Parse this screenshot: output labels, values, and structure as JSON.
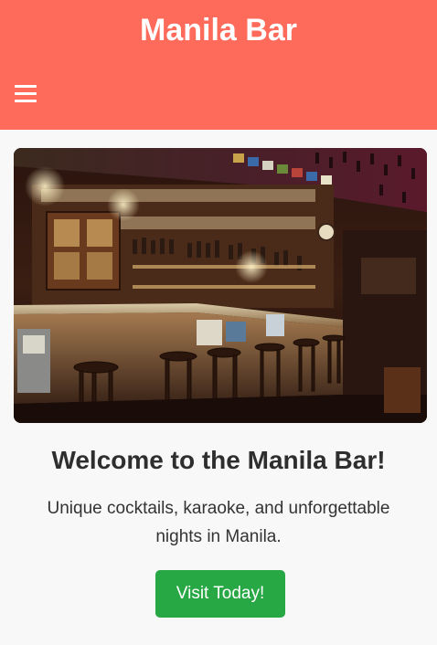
{
  "header": {
    "title": "Manila Bar",
    "menu_icon": "hamburger-menu-icon",
    "background_color": "#ff6b5a"
  },
  "hero": {
    "image": "bar-interior-photo"
  },
  "main": {
    "heading": "Welcome to the Manila Bar!",
    "tagline": "Unique cocktails, karaoke, and unforgettable nights in Manila.",
    "cta_label": "Visit Today!",
    "cta_color": "#28a745"
  }
}
